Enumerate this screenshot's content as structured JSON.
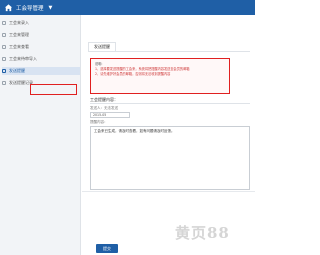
{
  "header": {
    "title": "工会导管理",
    "caret": "▼"
  },
  "sidebar": {
    "items": [
      {
        "label": "工会来录入"
      },
      {
        "label": "工会来管理"
      },
      {
        "label": "工会来查看"
      },
      {
        "label": "工会来待审导入"
      },
      {
        "label": "发送提醒"
      },
      {
        "label": "发送提醒记录"
      }
    ],
    "active_index": 4
  },
  "main": {
    "tab_label": "发送提醒",
    "notice": {
      "title": "说明:",
      "lines": [
        "1、选择要发送提醒的工会来，系统将把提醒内容发送至会员的邮箱",
        "2、请先维护好会员的邮箱，否则将无法收到提醒内容"
      ]
    },
    "section_title": "工会提醒内容：",
    "recipient_label": "发送人：无法发送",
    "select_value": "2015-05",
    "content_label": "提醒内容：",
    "textarea_text": "工会来已生成，请及时查看，如有问题请及时反馈。",
    "submit_label": "提交"
  },
  "watermark": "黄页88",
  "colors": {
    "header_bg": "#1f5fa6",
    "highlight_red": "#e02020",
    "active_item_bg": "#d8e3f2"
  }
}
